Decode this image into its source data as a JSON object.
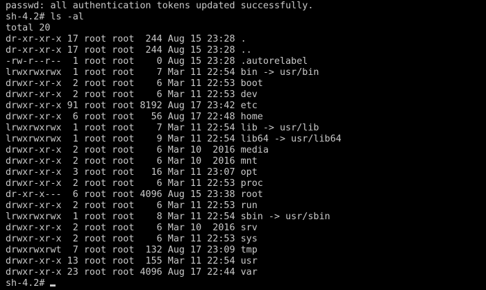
{
  "terminal": {
    "lines": [
      "passwd: all authentication tokens updated successfully.",
      "sh-4.2# ls -al",
      "total 20",
      "dr-xr-xr-x 17 root root  244 Aug 15 23:28 .",
      "dr-xr-xr-x 17 root root  244 Aug 15 23:28 ..",
      "-rw-r--r--  1 root root    0 Aug 15 23:28 .autorelabel",
      "lrwxrwxrwx  1 root root    7 Mar 11 22:54 bin -> usr/bin",
      "drwxr-xr-x  2 root root    6 Mar 11 22:53 boot",
      "drwxr-xr-x  2 root root    6 Mar 11 22:53 dev",
      "drwxr-xr-x 91 root root 8192 Aug 17 23:42 etc",
      "drwxr-xr-x  6 root root   56 Aug 17 22:48 home",
      "lrwxrwxrwx  1 root root    7 Mar 11 22:54 lib -> usr/lib",
      "lrwxrwxrwx  1 root root    9 Mar 11 22:54 lib64 -> usr/lib64",
      "drwxr-xr-x  2 root root    6 Mar 10  2016 media",
      "drwxr-xr-x  2 root root    6 Mar 10  2016 mnt",
      "drwxr-xr-x  3 root root   16 Mar 11 23:07 opt",
      "drwxr-xr-x  2 root root    6 Mar 11 22:53 proc",
      "dr-xr-x---  6 root root 4096 Aug 15 23:38 root",
      "drwxr-xr-x  2 root root    6 Mar 11 22:53 run",
      "lrwxrwxrwx  1 root root    8 Mar 11 22:54 sbin -> usr/sbin",
      "drwxr-xr-x  2 root root    6 Mar 10  2016 srv",
      "drwxr-xr-x  2 root root    6 Mar 11 22:53 sys",
      "drwxrwxrwt  7 root root  132 Aug 17 23:09 tmp",
      "drwxr-xr-x 13 root root  155 Mar 11 22:54 usr",
      "drwxr-xr-x 23 root root 4096 Aug 17 22:44 var"
    ],
    "prompt": "sh-4.2#",
    "colors": {
      "background": "#000000",
      "foreground": "#c9c9c9"
    }
  }
}
